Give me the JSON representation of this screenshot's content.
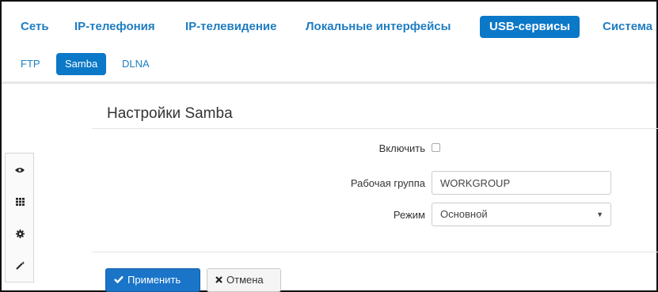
{
  "top_nav": {
    "items": [
      {
        "label": "Сеть",
        "active": false
      },
      {
        "label": "IP-телефония",
        "active": false
      },
      {
        "label": "IP-телевидение",
        "active": false
      },
      {
        "label": "Локальные интерфейсы",
        "active": false
      },
      {
        "label": "USB-сервисы",
        "active": true
      },
      {
        "label": "Система",
        "active": false
      }
    ]
  },
  "sub_nav": {
    "items": [
      {
        "label": "FTP",
        "active": false
      },
      {
        "label": "Samba",
        "active": true
      },
      {
        "label": "DLNA",
        "active": false
      }
    ]
  },
  "sidebar_tools": [
    "eye-icon",
    "grid-icon",
    "gear-icon",
    "magic-wand-icon"
  ],
  "panel": {
    "title": "Настройки Samba",
    "fields": {
      "enable": {
        "label": "Включить",
        "checked": false
      },
      "workgroup": {
        "label": "Рабочая группа",
        "value": "WORKGROUP"
      },
      "mode": {
        "label": "Режим",
        "value": "Основной"
      }
    }
  },
  "buttons": {
    "apply": "Применить",
    "cancel": "Отмена"
  },
  "colors": {
    "accent": "#0b78c8",
    "link": "#1f7dc1"
  }
}
